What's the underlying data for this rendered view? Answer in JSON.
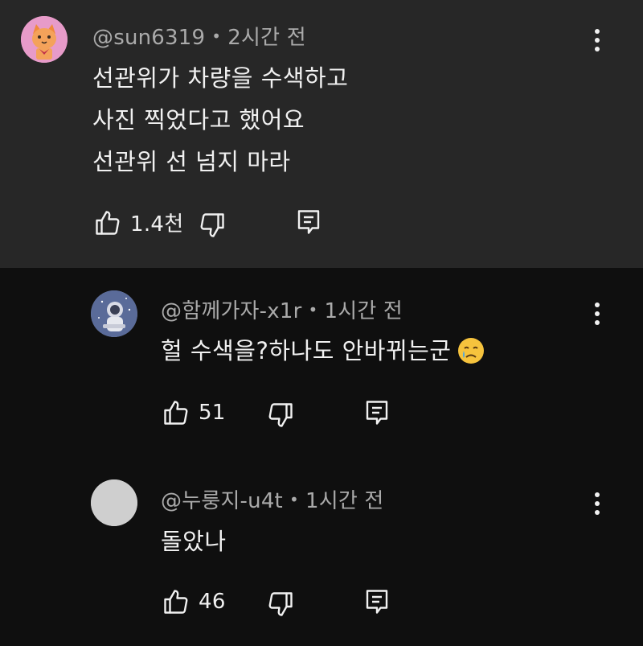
{
  "comments": [
    {
      "author": "@sun6319",
      "time": "2시간 전",
      "lines": [
        "선관위가 차량을 수색하고",
        "사진 찍었다고 했어요",
        "선관위 선 넘지 마라"
      ],
      "likes": "1.4천",
      "avatar_icon": "cat-avatar-icon",
      "avatar_color": "#e79bc9"
    },
    {
      "author": "@함께가자-x1r",
      "time": "1시간 전",
      "lines": [
        "헐 수색을?하나도 안바뀌는군"
      ],
      "emoji": "crying-face-emoji",
      "likes": "51",
      "avatar_icon": "astronaut-avatar-icon",
      "avatar_color": "#8090b8"
    },
    {
      "author": "@누룽지-u4t",
      "time": "1시간 전",
      "lines": [
        "돌았나"
      ],
      "likes": "46",
      "avatar_icon": "gray-circle-avatar-icon",
      "avatar_color": "#cfcfcf"
    }
  ],
  "meta_separator": "•",
  "icons": {
    "like": "thumbs-up-icon",
    "dislike": "thumbs-down-icon",
    "reply": "reply-icon",
    "menu": "more-vertical-icon"
  },
  "colors": {
    "background": "#0f0f0f",
    "highlight_background": "#272727",
    "primary_text": "#f1f1f1",
    "secondary_text": "#aaaaaa"
  }
}
